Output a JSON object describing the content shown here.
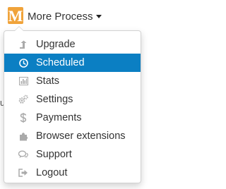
{
  "header": {
    "logo_letter": "M",
    "menu_title": "More Process"
  },
  "peek_text": "us",
  "colors": {
    "logo_bg": "#f0a33a",
    "active_bg": "#0b7fc3",
    "icon_gray": "#aaaaaa"
  },
  "dropdown": {
    "items": [
      {
        "label": "Upgrade",
        "icon": "upgrade-arrow-icon",
        "active": false
      },
      {
        "label": "Scheduled",
        "icon": "clock-icon",
        "active": true
      },
      {
        "label": "Stats",
        "icon": "bar-chart-icon",
        "active": false
      },
      {
        "label": "Settings",
        "icon": "gears-icon",
        "active": false
      },
      {
        "label": "Payments",
        "icon": "dollar-icon",
        "active": false
      },
      {
        "label": "Browser extensions",
        "icon": "puzzle-icon",
        "active": false
      },
      {
        "label": "Support",
        "icon": "chat-bubbles-icon",
        "active": false
      },
      {
        "label": "Logout",
        "icon": "logout-icon",
        "active": false
      }
    ]
  }
}
